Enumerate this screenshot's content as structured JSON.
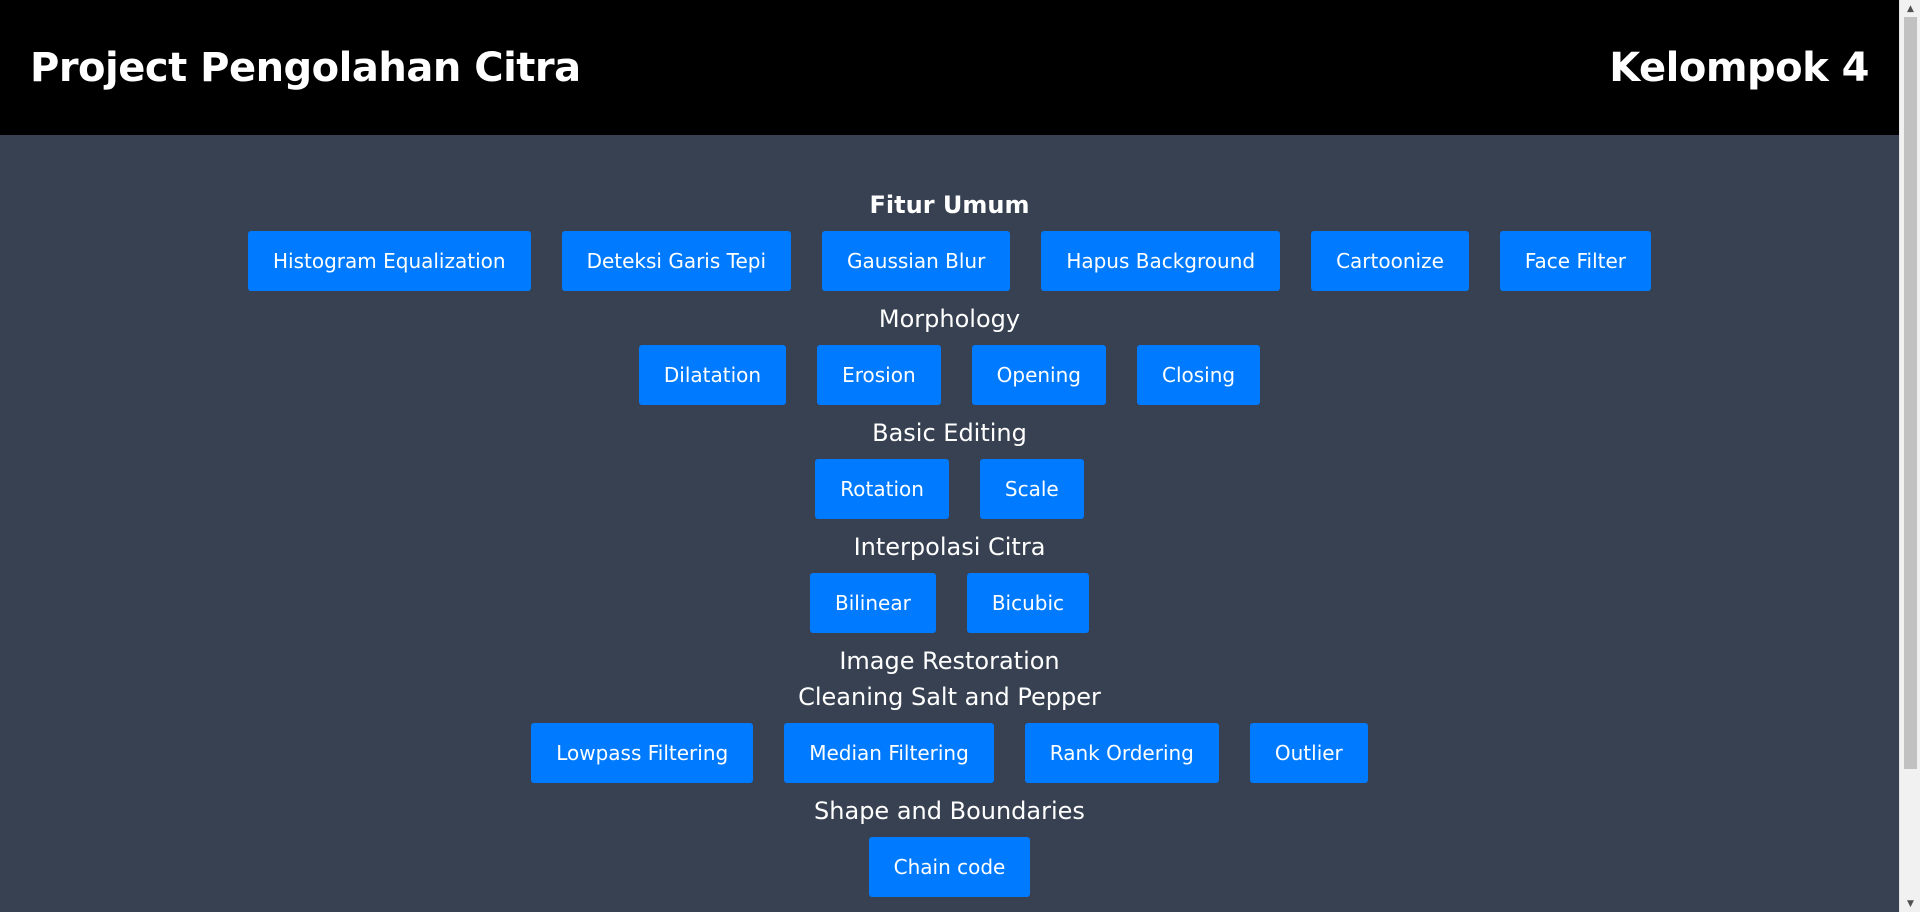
{
  "header": {
    "title": "Project Pengolahan Citra",
    "group": "Kelompok 4"
  },
  "sections": {
    "fitur_umum": {
      "title": "Fitur Umum",
      "buttons": [
        "Histogram Equalization",
        "Deteksi Garis Tepi",
        "Gaussian Blur",
        "Hapus Background",
        "Cartoonize",
        "Face Filter"
      ]
    },
    "morphology": {
      "title": "Morphology",
      "buttons": [
        "Dilatation",
        "Erosion",
        "Opening",
        "Closing"
      ]
    },
    "basic_editing": {
      "title": "Basic Editing",
      "buttons": [
        "Rotation",
        "Scale"
      ]
    },
    "interpolasi": {
      "title": "Interpolasi Citra",
      "buttons": [
        "Bilinear",
        "Bicubic"
      ]
    },
    "restoration": {
      "title": "Image Restoration",
      "subtitle": "Cleaning Salt and Pepper",
      "buttons": [
        "Lowpass Filtering",
        "Median Filtering",
        "Rank Ordering",
        "Outlier"
      ]
    },
    "shape": {
      "title": "Shape and Boundaries",
      "buttons": [
        "Chain code"
      ]
    }
  },
  "colors": {
    "header_bg": "#000000",
    "page_bg": "#374151",
    "button_bg": "#007bff",
    "text": "#ffffff"
  },
  "icons": {
    "scroll_up": "scroll-up-arrow-icon",
    "scroll_down": "scroll-down-arrow-icon"
  }
}
